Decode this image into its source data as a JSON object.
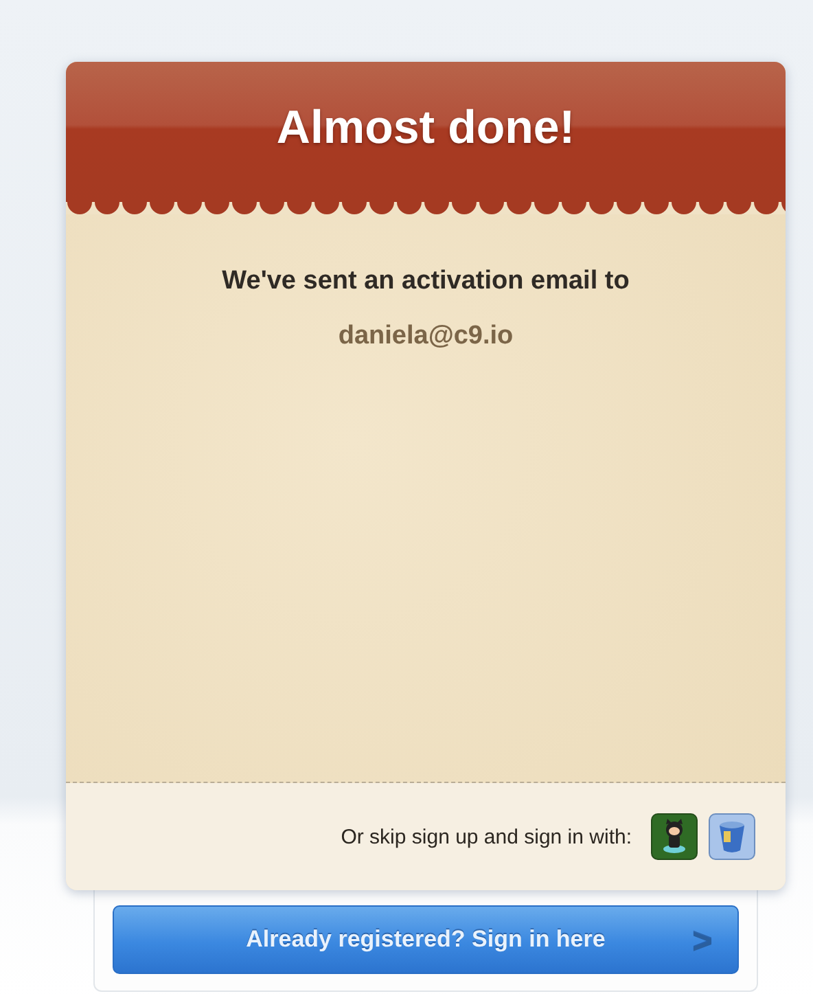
{
  "header": {
    "title": "Almost done!"
  },
  "message": {
    "text": "We've sent an activation email to",
    "email": "daniela@c9.io"
  },
  "footer": {
    "text": "Or skip sign up and sign in with:",
    "providers": [
      {
        "kind": "octocat"
      },
      {
        "kind": "bucket"
      }
    ]
  },
  "signin_button": {
    "label": "Already registered? Sign in here",
    "arrow": ">"
  }
}
